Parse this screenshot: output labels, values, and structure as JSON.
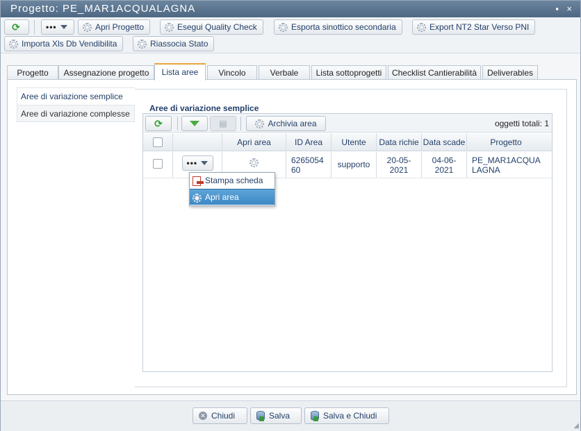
{
  "window": {
    "title": "Progetto: PE_MAR1ACQUALAGNA",
    "controls": "▪ ×"
  },
  "toolbar": {
    "more_label": "•••",
    "buttons": [
      "Apri Progetto",
      "Esegui Quality Check",
      "Esporta sinottico secondaria",
      "Export NT2 Star Verso PNI",
      "Importa Xls Db Vendibilita",
      "Riassocia Stato"
    ]
  },
  "tabs": [
    "Progetto",
    "Assegnazione progetto",
    "Lista aree",
    "Vincolo",
    "Verbale",
    "Lista sottoprogetti",
    "Checklist Cantierabilità",
    "Deliverables"
  ],
  "active_tab": "Lista aree",
  "sidenav": [
    "Aree di variazione semplice",
    "Aree di variazione complesse"
  ],
  "section_title": "Aree di variazione semplice",
  "grid": {
    "archive_label": "Archivia area",
    "count_label": "oggetti totali: 1",
    "columns": [
      "",
      "",
      "Apri area",
      "ID Area",
      "Utente",
      "Data richie",
      "Data scade",
      "Progetto"
    ],
    "rows": [
      {
        "actions_label": "•••",
        "id_area": "6265054 60",
        "utente": "supporto",
        "data_richiesta": "20-05- 2021",
        "data_scadenza": "04-06- 2021",
        "progetto": "PE_MAR1ACQUA LAGNA"
      }
    ]
  },
  "popup_menu": [
    "Stampa scheda",
    "Apri area"
  ],
  "footer": {
    "close": "Chiudi",
    "save": "Salva",
    "save_close": "Salva e Chiudi"
  }
}
